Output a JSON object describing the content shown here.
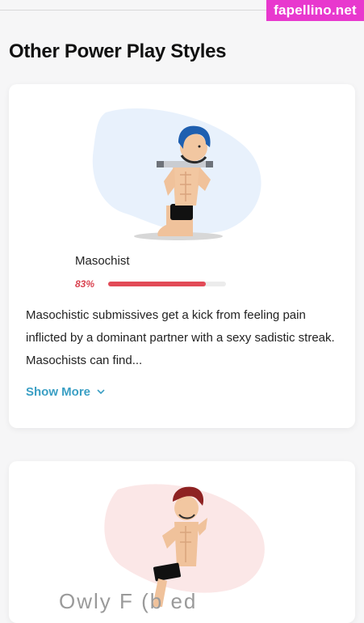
{
  "watermark": "fapellino.net",
  "section": {
    "title": "Other Power Play Styles"
  },
  "cards": [
    {
      "illustration_icon": "kneeling-gagged-man-illustration",
      "name": "Masochist",
      "percent_label": "83%",
      "percent_value": 83,
      "description": "Masochistic submissives get a kick from feeling pain inflicted by a dominant partner with a sexy sadistic streak. Masochists can find...",
      "show_more_label": "Show More",
      "accent_color": "#e24a57",
      "blob_color": "#e8f1fc"
    },
    {
      "illustration_icon": "fighting-man-illustration",
      "name_partial": "Owly F              (b    ed",
      "blob_color": "#fbe7e7"
    }
  ],
  "colors": {
    "link": "#3a9fc4",
    "percent": "#d94350"
  }
}
